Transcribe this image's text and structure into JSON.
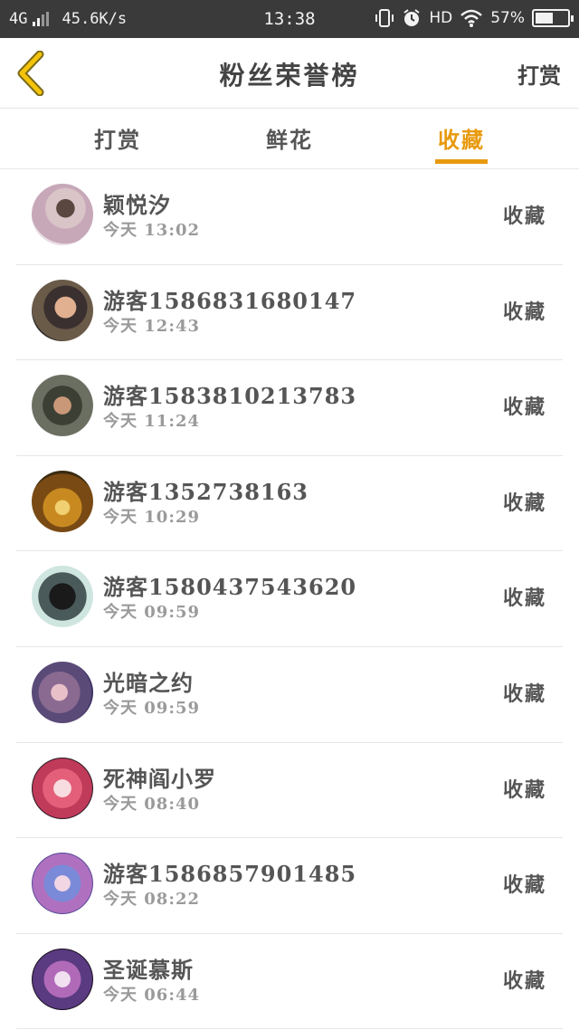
{
  "status_bar": {
    "network": "4G",
    "speed": "45.6K/s",
    "time": "13:38",
    "hd": "HD",
    "battery": "57%",
    "battery_level": 0.57,
    "icons": [
      "signal-icon",
      "vibrate-icon",
      "alarm-icon",
      "wifi-icon",
      "battery-icon"
    ]
  },
  "header": {
    "title": "粉丝荣誉榜",
    "action": "打赏",
    "back_icon": "chevron-left-icon",
    "accent_color": "#e89a0e"
  },
  "tabs": [
    {
      "label": "打赏",
      "active": false
    },
    {
      "label": "鲜花",
      "active": false
    },
    {
      "label": "收藏",
      "active": true
    }
  ],
  "list": [
    {
      "name": "颖悦汐",
      "time": "今天 13:02",
      "action": "收藏"
    },
    {
      "name": "游客1586831680147",
      "time": "今天 12:43",
      "action": "收藏"
    },
    {
      "name": "游客1583810213783",
      "time": "今天 11:24",
      "action": "收藏"
    },
    {
      "name": "游客1352738163",
      "time": "今天 10:29",
      "action": "收藏"
    },
    {
      "name": "游客1580437543620",
      "time": "今天 09:59",
      "action": "收藏"
    },
    {
      "name": "光暗之约",
      "time": "今天 09:59",
      "action": "收藏"
    },
    {
      "name": "死神阎小罗",
      "time": "今天 08:40",
      "action": "收藏"
    },
    {
      "name": "游客1586857901485",
      "time": "今天 08:22",
      "action": "收藏"
    },
    {
      "name": "圣诞慕斯",
      "time": "今天 06:44",
      "action": "收藏"
    }
  ]
}
